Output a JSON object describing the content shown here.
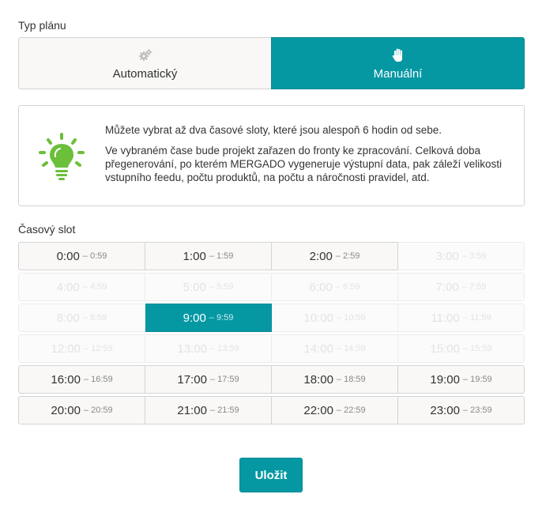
{
  "plan_type": {
    "label": "Typ plánu",
    "options": [
      {
        "label": "Automatický",
        "icon": "gears-icon",
        "selected": false
      },
      {
        "label": "Manuální",
        "icon": "hand-icon",
        "selected": true
      }
    ]
  },
  "info": {
    "icon": "lightbulb-icon",
    "line1": "Můžete vybrat až dva časové sloty, které jsou alespoň 6 hodin od sebe.",
    "line2": "Ve vybraném čase bude projekt zařazen do fronty ke zpracování. Celková doba přegenerování, po kterém MERGADO vygeneruje výstupní data, pak záleží velikosti vstupního feedu, počtu produktů, na počtu a náročnosti pravidel, atd."
  },
  "slots": {
    "label": "Časový slot",
    "rows": [
      [
        {
          "start": "0:00",
          "end": "– 0:59",
          "state": "enabled"
        },
        {
          "start": "1:00",
          "end": "– 1:59",
          "state": "enabled"
        },
        {
          "start": "2:00",
          "end": "– 2:59",
          "state": "enabled"
        },
        {
          "start": "3:00",
          "end": "– 3:59",
          "state": "disabled"
        }
      ],
      [
        {
          "start": "4:00",
          "end": "– 4:59",
          "state": "disabled"
        },
        {
          "start": "5:00",
          "end": "– 5:59",
          "state": "disabled"
        },
        {
          "start": "6:00",
          "end": "– 6:59",
          "state": "disabled"
        },
        {
          "start": "7:00",
          "end": "– 7:59",
          "state": "disabled"
        }
      ],
      [
        {
          "start": "8:00",
          "end": "– 8:59",
          "state": "disabled"
        },
        {
          "start": "9:00",
          "end": "– 9:59",
          "state": "selected"
        },
        {
          "start": "10:00",
          "end": "– 10:59",
          "state": "disabled"
        },
        {
          "start": "11:00",
          "end": "– 11:59",
          "state": "disabled"
        }
      ],
      [
        {
          "start": "12:00",
          "end": "– 12:59",
          "state": "disabled"
        },
        {
          "start": "13:00",
          "end": "– 13:59",
          "state": "disabled"
        },
        {
          "start": "14:00",
          "end": "– 14:59",
          "state": "disabled"
        },
        {
          "start": "15:00",
          "end": "– 15:59",
          "state": "disabled"
        }
      ],
      [
        {
          "start": "16:00",
          "end": "– 16:59",
          "state": "enabled"
        },
        {
          "start": "17:00",
          "end": "– 17:59",
          "state": "enabled"
        },
        {
          "start": "18:00",
          "end": "– 18:59",
          "state": "enabled"
        },
        {
          "start": "19:00",
          "end": "– 19:59",
          "state": "enabled"
        }
      ],
      [
        {
          "start": "20:00",
          "end": "– 20:59",
          "state": "enabled"
        },
        {
          "start": "21:00",
          "end": "– 21:59",
          "state": "enabled"
        },
        {
          "start": "22:00",
          "end": "– 22:59",
          "state": "enabled"
        },
        {
          "start": "23:00",
          "end": "– 23:59",
          "state": "enabled"
        }
      ]
    ]
  },
  "save_button": {
    "label": "Uložit"
  },
  "colors": {
    "accent": "#0598a3",
    "bulb": "#6cbf3a"
  }
}
